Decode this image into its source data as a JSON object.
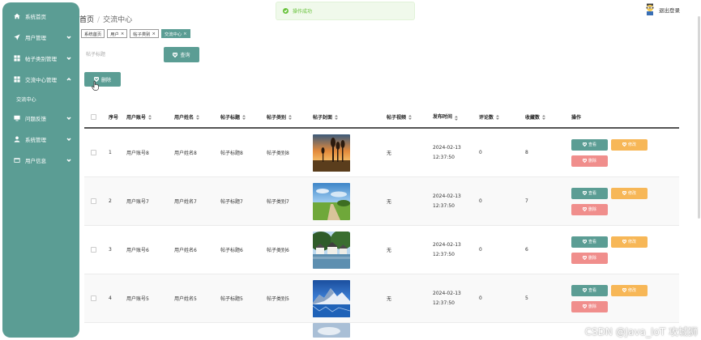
{
  "sidebar": {
    "items": [
      {
        "label": "系统首页",
        "icon": "home-icon",
        "arrow": false
      },
      {
        "label": "用户管理",
        "icon": "send-icon",
        "arrow": true
      },
      {
        "label": "帖子类别管理",
        "icon": "grid-icon",
        "arrow": true
      },
      {
        "label": "交流中心管理",
        "icon": "grid-icon",
        "arrow": true,
        "expanded": true
      },
      {
        "label": "问题反馈",
        "icon": "monitor-icon",
        "arrow": true
      },
      {
        "label": "系统管理",
        "icon": "user-icon",
        "arrow": true
      },
      {
        "label": "用户信息",
        "icon": "card-icon",
        "arrow": true
      }
    ],
    "submenu": "交流中心"
  },
  "header": {
    "home": "首页",
    "separator": "/",
    "current": "交流中心",
    "logout": "退出登录"
  },
  "toast": {
    "message": "操作成功"
  },
  "tags": [
    {
      "label": "系统首页",
      "closable": false,
      "active": false
    },
    {
      "label": "用户",
      "closable": true,
      "active": false
    },
    {
      "label": "帖子类别",
      "closable": true,
      "active": false
    },
    {
      "label": "交流中心",
      "closable": true,
      "active": true
    }
  ],
  "search": {
    "placeholder": "帖子标题",
    "button": "查询"
  },
  "delete_button": "删除",
  "table": {
    "headers": {
      "no": "序号",
      "account": "用户账号",
      "name": "用户姓名",
      "title": "帖子标题",
      "type": "帖子类别",
      "cover": "帖子封面",
      "video": "帖子视频",
      "time": "发布时间",
      "comments": "评论数",
      "favorites": "收藏数",
      "ops": "操作"
    },
    "ops": {
      "view": "查看",
      "edit": "修改",
      "delete": "删除"
    },
    "rows": [
      {
        "no": "1",
        "account": "用户账号8",
        "name": "用户姓名8",
        "title": "帖子标题8",
        "type": "帖子类别8",
        "video": "无",
        "time": "2024-02-13 12:37:50",
        "comments": "0",
        "favorites": "8",
        "cover": "sunset-trees"
      },
      {
        "no": "2",
        "account": "用户账号7",
        "name": "用户姓名7",
        "title": "帖子标题7",
        "type": "帖子类别7",
        "video": "无",
        "time": "2024-02-13 12:37:50",
        "comments": "0",
        "favorites": "7",
        "cover": "meadow-path"
      },
      {
        "no": "3",
        "account": "用户账号6",
        "name": "用户姓名6",
        "title": "帖子标题6",
        "type": "帖子类别6",
        "video": "无",
        "time": "2024-02-13 12:37:50",
        "comments": "0",
        "favorites": "6",
        "cover": "lakeside-village"
      },
      {
        "no": "4",
        "account": "用户账号5",
        "name": "用户姓名5",
        "title": "帖子标题5",
        "type": "帖子类别5",
        "video": "无",
        "time": "2024-02-13 12:37:50",
        "comments": "0",
        "favorites": "5",
        "cover": "mountain-lake"
      }
    ]
  },
  "watermark": "CSDN @Java_IoT 攻城狮",
  "colors": {
    "primary": "#5b9d94",
    "edit": "#f7b757",
    "delete": "#f08e8c",
    "success": "#67c23a"
  }
}
